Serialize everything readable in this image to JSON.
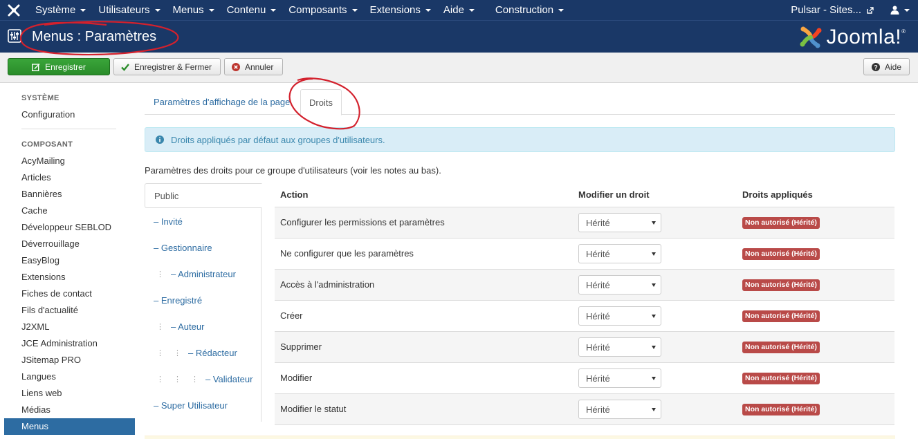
{
  "navbar": {
    "menus": [
      {
        "label": "Système"
      },
      {
        "label": "Utilisateurs"
      },
      {
        "label": "Menus"
      },
      {
        "label": "Contenu"
      },
      {
        "label": "Composants"
      },
      {
        "label": "Extensions"
      },
      {
        "label": "Aide"
      },
      {
        "label": "Construction"
      }
    ],
    "site_label": "Pulsar - Sites...",
    "user_icon": "user-icon",
    "external_icon": "external-link-icon"
  },
  "titlebar": {
    "title": "Menus : Paramètres",
    "brand": "Joomla!",
    "brand_mark": "®"
  },
  "toolbar": {
    "save_label": "Enregistrer",
    "save_close_label": "Enregistrer & Fermer",
    "cancel_label": "Annuler",
    "help_label": "Aide"
  },
  "sidebar": {
    "section_system": "SYSTÈME",
    "system_items": [
      "Configuration"
    ],
    "section_component": "COMPOSANT",
    "component_items": [
      "AcyMailing",
      "Articles",
      "Bannières",
      "Cache",
      "Développeur SEBLOD",
      "Déverrouillage",
      "EasyBlog",
      "Extensions",
      "Fiches de contact",
      "Fils d'actualité",
      "J2XML",
      "JCE Administration",
      "JSitemap PRO",
      "Langues",
      "Liens web",
      "Médias"
    ],
    "active_item": "Menus"
  },
  "tabs": {
    "display": "Paramètres d'affichage de la page",
    "rights": "Droits",
    "active": "rights"
  },
  "alert": {
    "text": "Droits appliqués par défaut aux groupes d'utilisateurs."
  },
  "notes": "Paramètres des droits pour ce groupe d'utilisateurs (voir les notes au bas).",
  "groups": {
    "active": "Public",
    "items": [
      {
        "label": "– Invité",
        "depth": 0
      },
      {
        "label": "– Gestionnaire",
        "depth": 0
      },
      {
        "label": "– Administrateur",
        "depth": 1
      },
      {
        "label": "– Enregistré",
        "depth": 0
      },
      {
        "label": "– Auteur",
        "depth": 1
      },
      {
        "label": "– Rédacteur",
        "depth": 2
      },
      {
        "label": "– Validateur",
        "depth": 3
      },
      {
        "label": "– Super Utilisateur",
        "depth": 0
      }
    ]
  },
  "rights_table": {
    "headers": {
      "action": "Action",
      "modify": "Modifier un droit",
      "applied": "Droits appliqués"
    },
    "rows": [
      {
        "action": "Configurer les permissions et paramètres",
        "select": "Hérité",
        "applied": "Non autorisé (Hérité)"
      },
      {
        "action": "Ne configurer que les paramètres",
        "select": "Hérité",
        "applied": "Non autorisé (Hérité)"
      },
      {
        "action": "Accès à l'administration",
        "select": "Hérité",
        "applied": "Non autorisé (Hérité)"
      },
      {
        "action": "Créer",
        "select": "Hérité",
        "applied": "Non autorisé (Hérité)"
      },
      {
        "action": "Supprimer",
        "select": "Hérité",
        "applied": "Non autorisé (Hérité)"
      },
      {
        "action": "Modifier",
        "select": "Hérité",
        "applied": "Non autorisé (Hérité)"
      },
      {
        "action": "Modifier le statut",
        "select": "Hérité",
        "applied": "Non autorisé (Hérité)"
      }
    ]
  },
  "colors": {
    "navbar": "#1a3867",
    "link": "#2d6ca2",
    "save_button": "#2f962f",
    "badge_danger": "#b94a48",
    "alert_bg": "#d9edf7",
    "annotation": "#d3212d"
  }
}
